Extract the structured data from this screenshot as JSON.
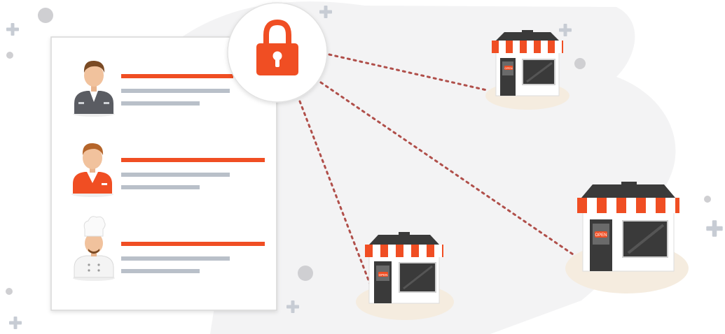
{
  "colors": {
    "accent": "#f04e23",
    "line_gray": "#b9c0c9",
    "panel_border": "#d7d7d7",
    "shape_gray": "#f3f3f4",
    "deco_gray": "#cfcfd2",
    "store_dark": "#3a3a3a",
    "connector": "#b04f4a",
    "store_shadow": "#f5ecdf"
  },
  "icons": {
    "lock": "lock-icon",
    "plus": "plus-icon",
    "store": "store-icon",
    "avatar_manager": "manager-avatar-icon",
    "avatar_cashier": "cashier-avatar-icon",
    "avatar_chef": "chef-avatar-icon"
  },
  "employees": [
    {
      "role_icon": "manager-avatar-icon"
    },
    {
      "role_icon": "cashier-avatar-icon"
    },
    {
      "role_icon": "chef-avatar-icon"
    }
  ],
  "stores": [
    {
      "sign": "OPEN"
    },
    {
      "sign": "OPEN"
    },
    {
      "sign": "OPEN"
    }
  ]
}
